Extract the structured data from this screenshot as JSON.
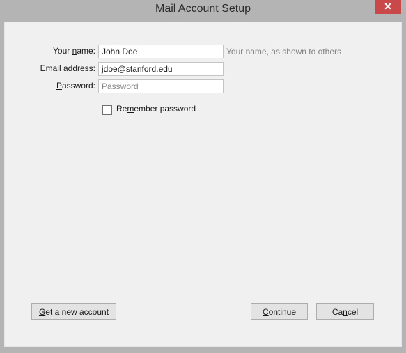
{
  "window": {
    "title": "Mail Account Setup",
    "close_icon": "close-icon"
  },
  "form": {
    "name": {
      "label_pre": "Your ",
      "label_key": "n",
      "label_post": "ame:",
      "value": "John Doe",
      "hint": "Your name, as shown to others"
    },
    "email": {
      "label_pre": "Emai",
      "label_key": "l",
      "label_post": " address:",
      "value": "jdoe@stanford.edu"
    },
    "password": {
      "label_pre": "",
      "label_key": "P",
      "label_post": "assword:",
      "value": "",
      "placeholder": "Password"
    },
    "remember": {
      "label_pre": "Re",
      "label_key": "m",
      "label_post": "ember password",
      "checked": false
    }
  },
  "buttons": {
    "new_account": {
      "pre": "",
      "key": "G",
      "post": "et a new account"
    },
    "continue": {
      "pre": "",
      "key": "C",
      "post": "ontinue"
    },
    "cancel": {
      "pre": "Ca",
      "key": "n",
      "post": "cel"
    }
  }
}
